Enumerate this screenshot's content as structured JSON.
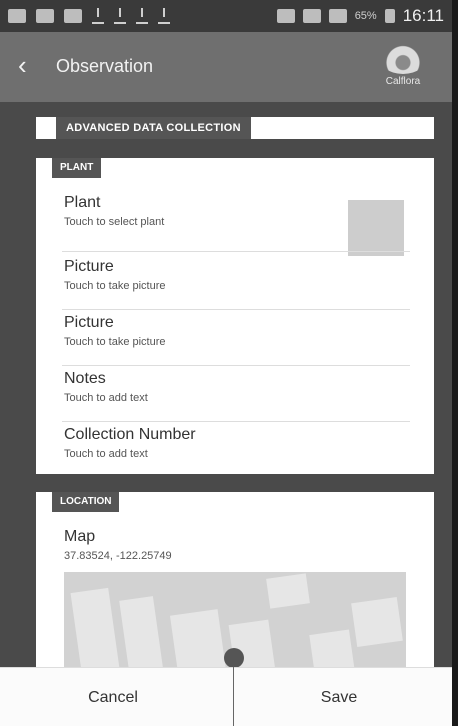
{
  "status_bar": {
    "battery": "65%",
    "time": "16:11"
  },
  "app_bar": {
    "back_icon": "chevron-left-icon",
    "title": "Observation",
    "logo_text": "Calflora"
  },
  "form": {
    "header": "ADVANCED DATA COLLECTION",
    "plant_section": {
      "tag": "PLANT",
      "rows": [
        {
          "title": "Plant",
          "sub": "Touch to select plant"
        },
        {
          "title": "Picture",
          "sub": "Touch to take picture"
        },
        {
          "title": "Picture",
          "sub": "Touch to take picture"
        },
        {
          "title": "Notes",
          "sub": "Touch to add text"
        },
        {
          "title": "Collection Number",
          "sub": "Touch to add text"
        }
      ]
    },
    "location_section": {
      "tag": "LOCATION",
      "title": "Map",
      "coords": "37.83524, -122.25749"
    }
  },
  "actions": {
    "cancel": "Cancel",
    "save": "Save"
  },
  "colors": {
    "app_bar": "#6f6f6f",
    "status_bar": "#3a3a3a",
    "background": "#4a4a4a"
  }
}
